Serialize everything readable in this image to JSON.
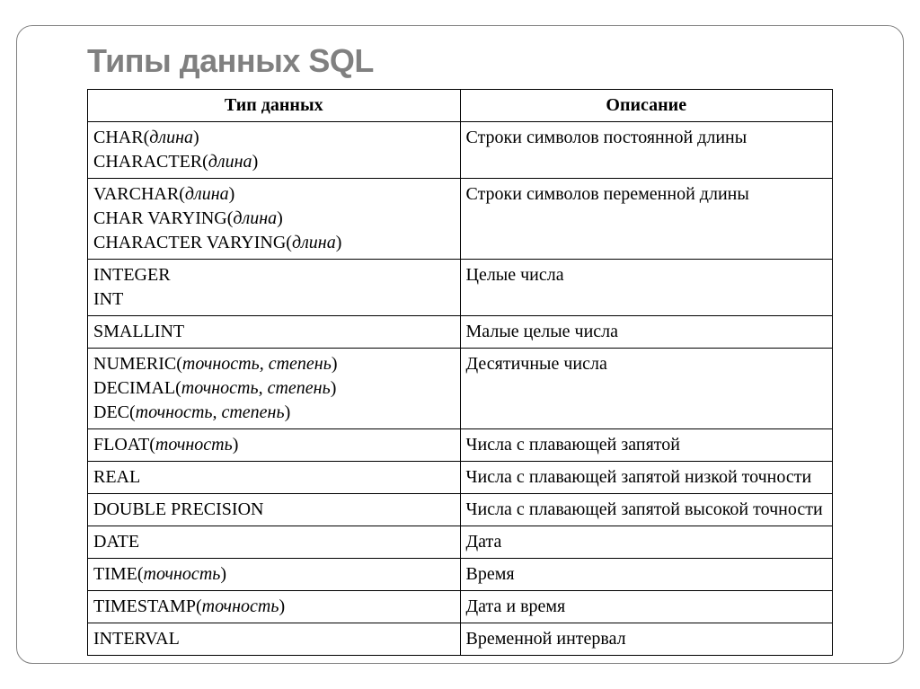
{
  "title": "Типы данных SQL",
  "headers": {
    "col1": "Тип данных",
    "col2": "Описание"
  },
  "rows": [
    {
      "lines": [
        {
          "prefix": "CHAR(",
          "italic": "длина",
          "suffix": ")"
        },
        {
          "prefix": "CHARACTER(",
          "italic": "длина",
          "suffix": ")"
        }
      ],
      "desc": "Строки символов постоянной длины"
    },
    {
      "lines": [
        {
          "prefix": "VARCHAR(",
          "italic": "длина",
          "suffix": ")"
        },
        {
          "prefix": "CHAR VARYING(",
          "italic": "длина",
          "suffix": ")"
        },
        {
          "prefix": "CHARACTER VARYING(",
          "italic": "длина",
          "suffix": ")"
        }
      ],
      "desc": "Строки символов переменной длины"
    },
    {
      "lines": [
        {
          "prefix": "INTEGER",
          "italic": "",
          "suffix": ""
        },
        {
          "prefix": "INT",
          "italic": "",
          "suffix": ""
        }
      ],
      "desc": "Целые числа"
    },
    {
      "lines": [
        {
          "prefix": "SMALLINT",
          "italic": "",
          "suffix": ""
        }
      ],
      "desc": "Малые целые числа"
    },
    {
      "lines": [
        {
          "prefix": "NUMERIC(",
          "italic": "точность, степень",
          "suffix": ")"
        },
        {
          "prefix": "DECIMAL(",
          "italic": "точность, степень",
          "suffix": ")"
        },
        {
          "prefix": "DEC(",
          "italic": "точность, степень",
          "suffix": ")"
        }
      ],
      "desc": "Десятичные числа"
    },
    {
      "lines": [
        {
          "prefix": "FLOAT(",
          "italic": "точность",
          "suffix": ")"
        }
      ],
      "desc": "Числа с плавающей запятой"
    },
    {
      "lines": [
        {
          "prefix": "REAL",
          "italic": "",
          "suffix": ""
        }
      ],
      "desc": "Числа с плавающей запятой низкой точности"
    },
    {
      "lines": [
        {
          "prefix": "DOUBLE PRECISION",
          "italic": "",
          "suffix": ""
        }
      ],
      "desc": "Числа с плавающей запятой высокой точности"
    },
    {
      "lines": [
        {
          "prefix": "DATE",
          "italic": "",
          "suffix": ""
        }
      ],
      "desc": "Дата"
    },
    {
      "lines": [
        {
          "prefix": "TIME(",
          "italic": "точность",
          "suffix": ")"
        }
      ],
      "desc": "Время"
    },
    {
      "lines": [
        {
          "prefix": "TIMESTAMP(",
          "italic": "точность",
          "suffix": ")"
        }
      ],
      "desc": "Дата и время"
    },
    {
      "lines": [
        {
          "prefix": "INTERVAL",
          "italic": "",
          "suffix": ""
        }
      ],
      "desc": "Временной интервал"
    }
  ]
}
